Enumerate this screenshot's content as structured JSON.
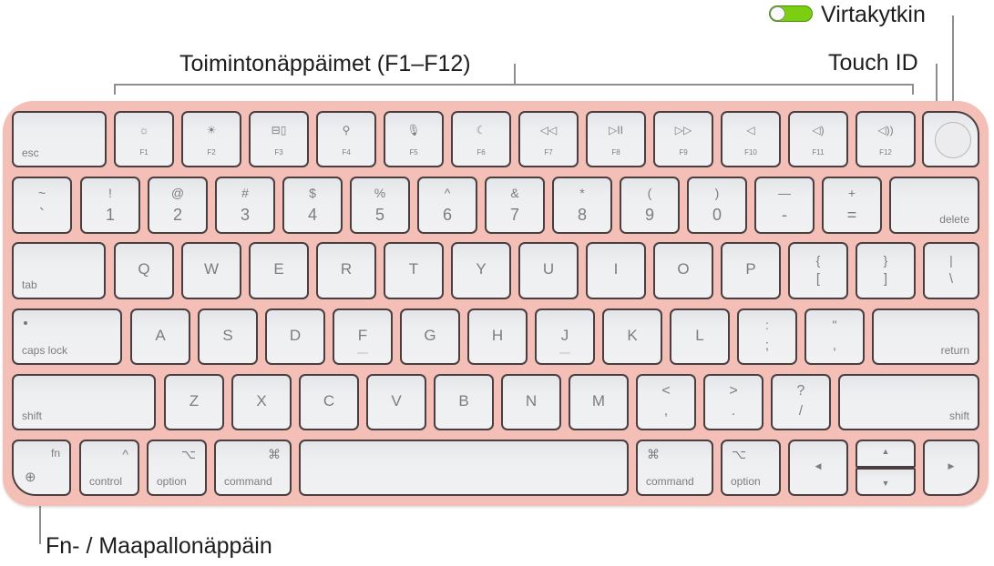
{
  "callouts": {
    "function_keys": "Toimintonäppäimet (F1–F12)",
    "power_switch": "Virtakytkin",
    "touch_id": "Touch ID",
    "fn_globe": "Fn- / Maapallonäppäin"
  },
  "colors": {
    "keyboard_body": "#f4bfb6",
    "key_face": "#eeeff1",
    "switch_on": "#7ccf10"
  },
  "row_fn": {
    "esc": "esc",
    "fkeys": [
      {
        "label": "F1",
        "icon": "brightness-down-icon",
        "glyph": "☼"
      },
      {
        "label": "F2",
        "icon": "brightness-up-icon",
        "glyph": "☀"
      },
      {
        "label": "F3",
        "icon": "mission-control-icon",
        "glyph": "⊟▯"
      },
      {
        "label": "F4",
        "icon": "search-icon",
        "glyph": "⚲"
      },
      {
        "label": "F5",
        "icon": "microphone-icon",
        "glyph": "🎙"
      },
      {
        "label": "F6",
        "icon": "moon-icon",
        "glyph": "☾"
      },
      {
        "label": "F7",
        "icon": "rewind-icon",
        "glyph": "◁◁"
      },
      {
        "label": "F8",
        "icon": "play-pause-icon",
        "glyph": "▷II"
      },
      {
        "label": "F9",
        "icon": "fast-forward-icon",
        "glyph": "▷▷"
      },
      {
        "label": "F10",
        "icon": "mute-icon",
        "glyph": "◁"
      },
      {
        "label": "F11",
        "icon": "volume-down-icon",
        "glyph": "◁)"
      },
      {
        "label": "F12",
        "icon": "volume-up-icon",
        "glyph": "◁))"
      }
    ]
  },
  "row_num": {
    "keys": [
      {
        "top": "~",
        "bottom": "`"
      },
      {
        "top": "!",
        "bottom": "1"
      },
      {
        "top": "@",
        "bottom": "2"
      },
      {
        "top": "#",
        "bottom": "3"
      },
      {
        "top": "$",
        "bottom": "4"
      },
      {
        "top": "%",
        "bottom": "5"
      },
      {
        "top": "^",
        "bottom": "6"
      },
      {
        "top": "&",
        "bottom": "7"
      },
      {
        "top": "*",
        "bottom": "8"
      },
      {
        "top": "(",
        "bottom": "9"
      },
      {
        "top": ")",
        "bottom": "0"
      },
      {
        "top": "—",
        "bottom": "-"
      },
      {
        "top": "+",
        "bottom": "="
      }
    ],
    "delete": "delete"
  },
  "row_q": {
    "tab": "tab",
    "letters": [
      "Q",
      "W",
      "E",
      "R",
      "T",
      "Y",
      "U",
      "I",
      "O",
      "P"
    ],
    "brackets": [
      {
        "top": "{",
        "bottom": "["
      },
      {
        "top": "}",
        "bottom": "]"
      },
      {
        "top": "|",
        "bottom": "\\"
      }
    ]
  },
  "row_a": {
    "caps": "caps lock",
    "letters": [
      "A",
      "S",
      "D",
      "F",
      "G",
      "H",
      "J",
      "K",
      "L"
    ],
    "punct": [
      {
        "top": ":",
        "bottom": ";"
      },
      {
        "top": "\"",
        "bottom": ","
      }
    ],
    "return": "return"
  },
  "row_z": {
    "shift_left": "shift",
    "letters": [
      "Z",
      "X",
      "C",
      "V",
      "B",
      "N",
      "M"
    ],
    "punct": [
      {
        "top": "<",
        "bottom": ","
      },
      {
        "top": ">",
        "bottom": "."
      },
      {
        "top": "?",
        "bottom": "/"
      }
    ],
    "shift_right": "shift"
  },
  "row_bottom": {
    "fn": "fn",
    "control": "control",
    "control_symbol": "^",
    "option": "option",
    "option_symbol": "⌥",
    "command": "command",
    "command_symbol": "⌘",
    "arrow_left": "◀",
    "arrow_up": "▲",
    "arrow_down": "▼",
    "arrow_right": "▶"
  }
}
